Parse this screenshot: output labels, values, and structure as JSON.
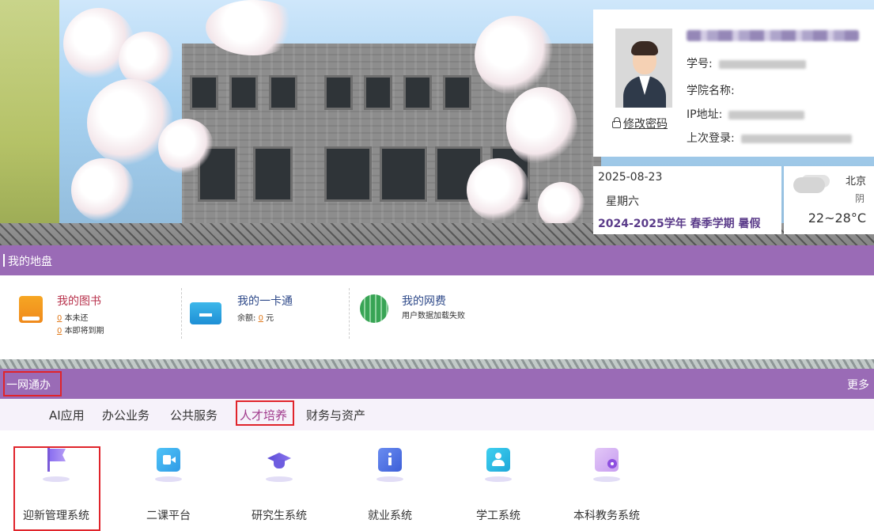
{
  "user": {
    "student_id_label": "学号:",
    "college_label": "学院名称:",
    "ip_label": "IP地址:",
    "last_login_label": "上次登录:",
    "change_password": "修改密码"
  },
  "date": {
    "date": "2025-08-23",
    "weekday": "星期六",
    "term": "2024-2025学年 春季学期 暑假"
  },
  "weather": {
    "city": "北京",
    "condition": "阴",
    "temperature": "22~28°C"
  },
  "my_territory": {
    "title": "我的地盘",
    "library": {
      "title": "我的图书",
      "line1_num": "0",
      "line1_text": "本未还",
      "line2_num": "0",
      "line2_text": "本即将到期"
    },
    "card": {
      "title": "我的一卡通",
      "balance_label": "余额:",
      "balance_num": "0",
      "balance_unit": "元"
    },
    "network": {
      "title": "我的网费",
      "status": "用户数据加载失败"
    }
  },
  "one_network": {
    "title": "一网通办",
    "more": "更多",
    "tabs": [
      "AI应用",
      "办公业务",
      "公共服务",
      "人才培养",
      "财务与资产"
    ],
    "active_tab": "人才培养",
    "apps": [
      "迎新管理系统",
      "二课平台",
      "研究生系统",
      "就业系统",
      "学工系统",
      "本科教务系统"
    ]
  },
  "colors": {
    "accent_purple": "#9a6bb6",
    "highlight_red": "#e0242b",
    "active_tab": "#a03a8c"
  }
}
